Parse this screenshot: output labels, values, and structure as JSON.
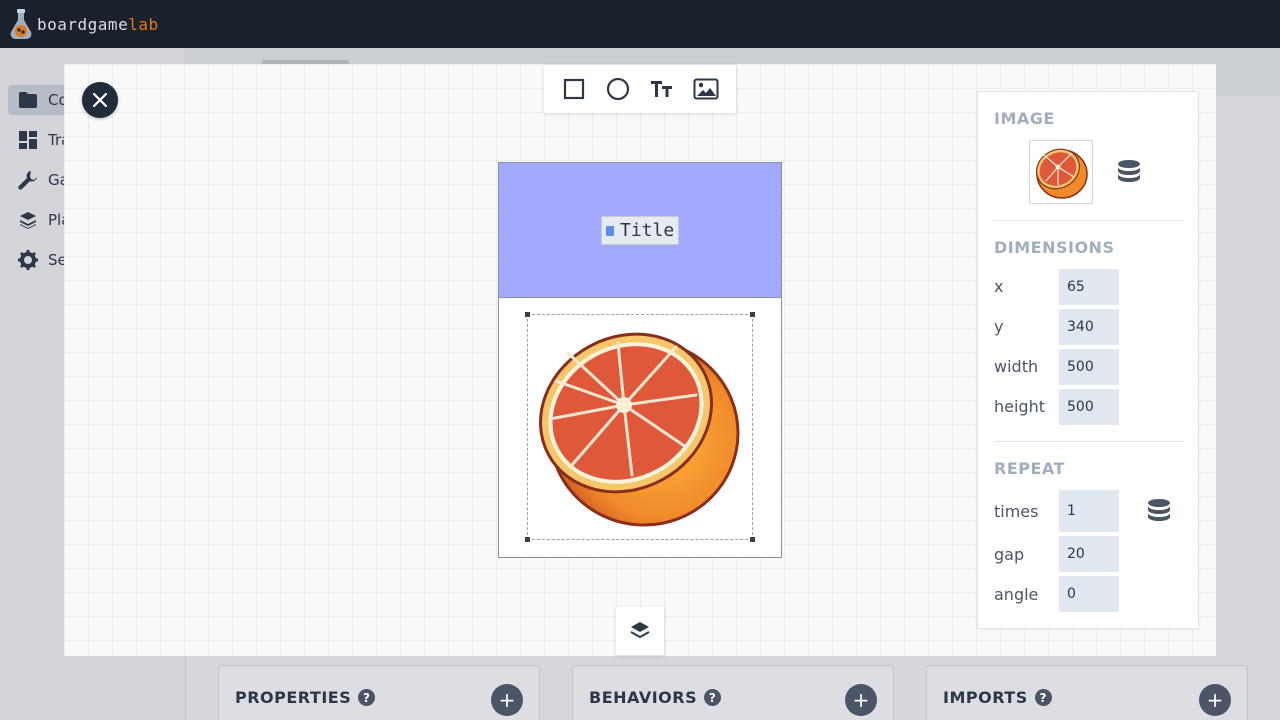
{
  "app": {
    "logo_a": "boardgame",
    "logo_b": "lab"
  },
  "sidebar": {
    "items": [
      {
        "label": "Co",
        "icon": "folder-icon",
        "active": true
      },
      {
        "label": "Tra",
        "icon": "dashboard-icon",
        "active": false
      },
      {
        "label": "Ga",
        "icon": "wrench-icon",
        "active": false
      },
      {
        "label": "Pla",
        "icon": "layers-icon",
        "active": false
      },
      {
        "label": "Se",
        "icon": "gear-icon",
        "active": false
      }
    ]
  },
  "panels": {
    "properties": "PROPERTIES",
    "behaviors": "BEHAVIORS",
    "imports": "IMPORTS",
    "help_glyph": "?",
    "add_glyph": "+"
  },
  "modal": {
    "toolbar": [
      "rectangle-tool",
      "circle-tool",
      "text-tool",
      "image-tool"
    ],
    "card": {
      "header_color": "#a0aaff",
      "title_chip": "Title"
    },
    "image_panel": {
      "image_title": "IMAGE",
      "dimensions_title": "DIMENSIONS",
      "x_label": "x",
      "x_value": "65",
      "y_label": "y",
      "y_value": "340",
      "width_label": "width",
      "width_value": "500",
      "height_label": "height",
      "height_value": "500",
      "repeat_title": "REPEAT",
      "times_label": "times",
      "times_value": "1",
      "gap_label": "gap",
      "gap_value": "20",
      "angle_label": "angle",
      "angle_value": "0"
    }
  },
  "colors": {
    "topbar": "#1a202c",
    "accent": "#dd7a1f",
    "header": "#a0aaff"
  }
}
